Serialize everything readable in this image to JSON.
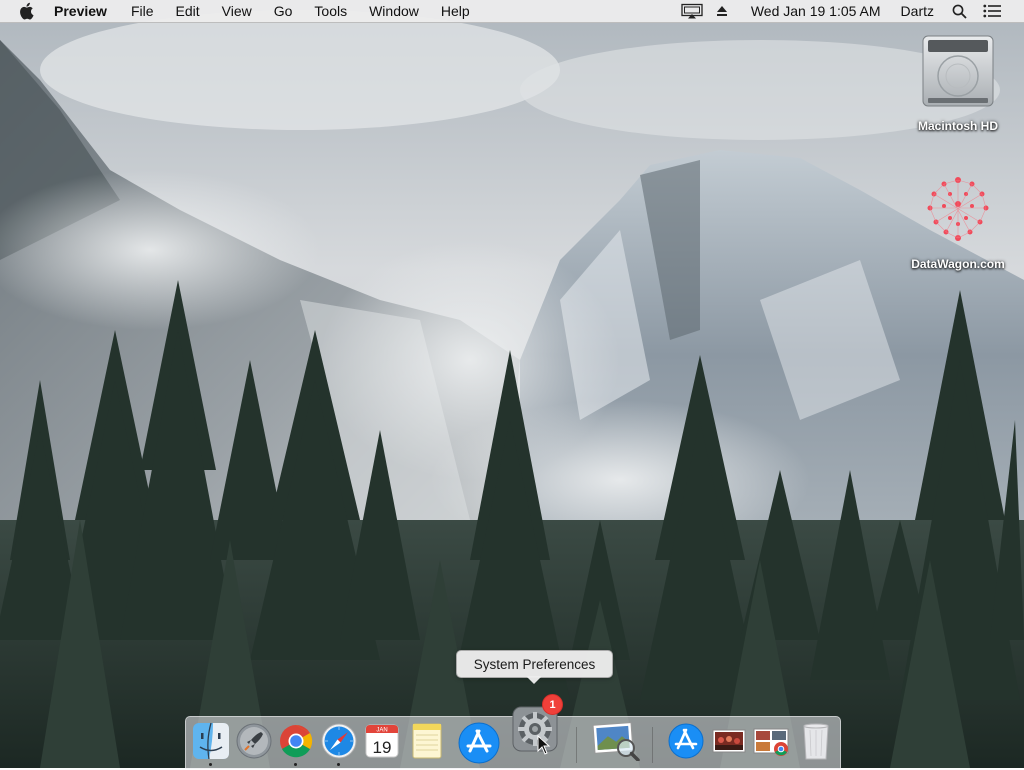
{
  "menubar": {
    "apple_icon": "apple-logo-icon",
    "app_name": "Preview",
    "menus": [
      "File",
      "Edit",
      "View",
      "Go",
      "Tools",
      "Window",
      "Help"
    ],
    "status": {
      "airplay_icon": "airplay-display-icon",
      "eject_icon": "eject-icon",
      "clock": "Wed Jan 19  1:05 AM",
      "user": "Dartz",
      "spotlight_icon": "search-icon",
      "notification_icon": "notification-center-icon"
    }
  },
  "desktop": {
    "icons": [
      {
        "label": "Macintosh HD",
        "icon": "hard-drive-icon"
      },
      {
        "label": "DataWagon.com",
        "icon": "network-volume-icon"
      }
    ]
  },
  "dock": {
    "tooltip": "System Preferences",
    "badge_count": "1",
    "calendar": {
      "month": "JAN",
      "day": "19"
    },
    "items": [
      {
        "name": "Finder",
        "icon": "finder-icon",
        "running": true
      },
      {
        "name": "Launchpad",
        "icon": "launchpad-icon",
        "running": false
      },
      {
        "name": "Google Chrome",
        "icon": "chrome-icon",
        "running": true
      },
      {
        "name": "Safari",
        "icon": "safari-icon",
        "running": true
      },
      {
        "name": "Calendar",
        "icon": "calendar-icon",
        "running": false
      },
      {
        "name": "Notes",
        "icon": "notes-icon",
        "running": false
      },
      {
        "name": "App Store",
        "icon": "app-store-icon",
        "running": false
      },
      {
        "name": "System Preferences",
        "icon": "system-preferences-icon",
        "running": false
      },
      {
        "name": "Preview",
        "icon": "preview-icon",
        "running": false
      },
      {
        "name": "Applications",
        "icon": "app-store-folder-icon",
        "running": false
      },
      {
        "name": "Photos stack",
        "icon": "photo-stack-icon",
        "running": false
      },
      {
        "name": "Downloads stack",
        "icon": "downloads-stack-icon",
        "running": false
      },
      {
        "name": "Trash",
        "icon": "trash-icon",
        "running": false
      }
    ]
  },
  "colors": {
    "menubar_bg": "#ececec",
    "badge": "#f0403a",
    "app_store_blue": "#1a8ef5"
  }
}
